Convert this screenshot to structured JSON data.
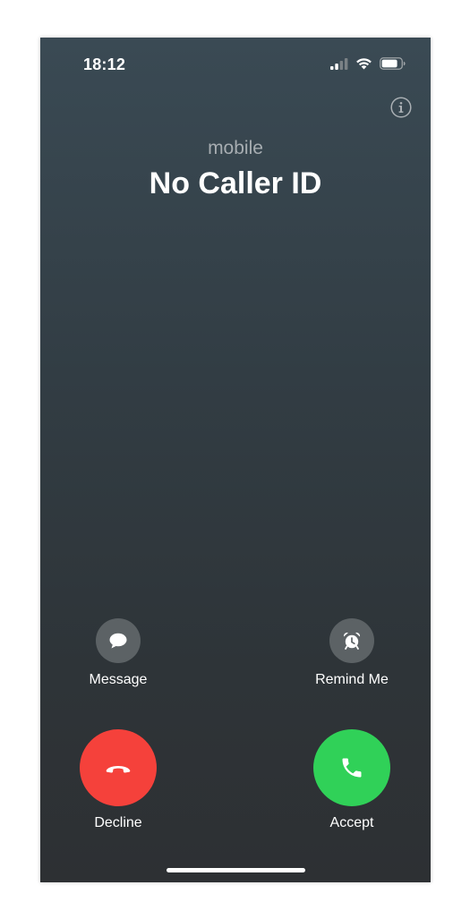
{
  "status_bar": {
    "time": "18:12"
  },
  "caller": {
    "label": "mobile",
    "name": "No Caller ID"
  },
  "actions": {
    "message_label": "Message",
    "remind_label": "Remind Me",
    "decline_label": "Decline",
    "accept_label": "Accept"
  },
  "colors": {
    "decline": "#f5413b",
    "accept": "#30d158",
    "secondary_button": "#5c6265"
  },
  "icons": {
    "info": "info-icon",
    "message": "speech-bubble-icon",
    "remind": "alarm-clock-icon",
    "decline": "phone-hangup-icon",
    "accept": "phone-icon"
  }
}
